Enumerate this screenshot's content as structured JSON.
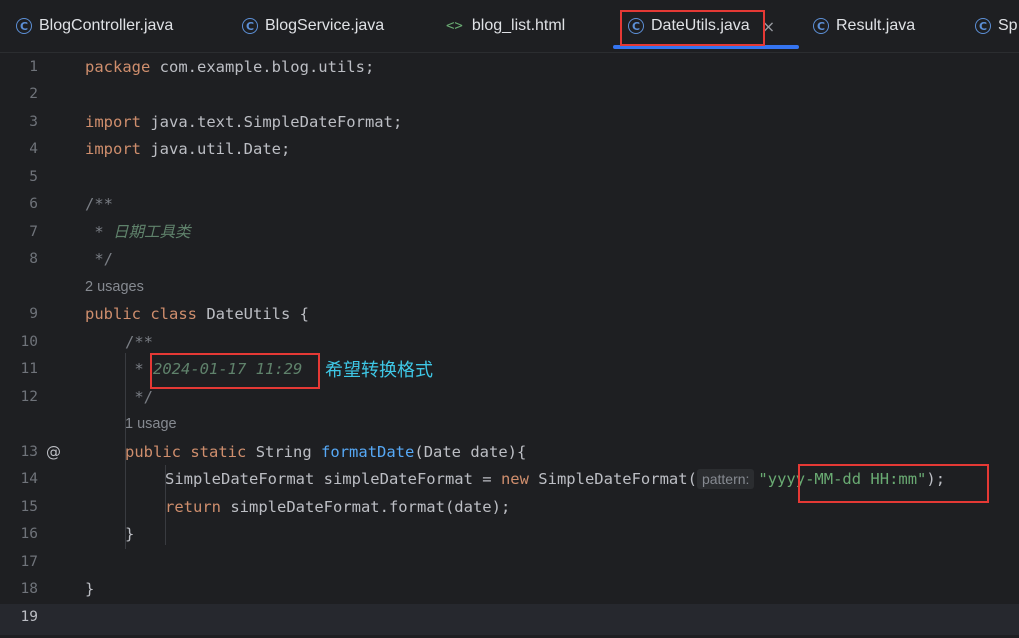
{
  "tabs": [
    {
      "label": "BlogController.java",
      "icon": "class-c-icon"
    },
    {
      "label": "BlogService.java",
      "icon": "class-c-icon"
    },
    {
      "label": "blog_list.html",
      "icon": "html-icon"
    },
    {
      "label": "DateUtils.java",
      "icon": "class-c-icon",
      "active": true
    },
    {
      "label": "Result.java",
      "icon": "class-c-icon"
    },
    {
      "label": "Sp",
      "icon": "class-c-icon"
    }
  ],
  "tab_close_glyph": "×",
  "class_icon_glyph": "C",
  "html_icon_glyph": "<>",
  "gutter_at_glyph": "@",
  "annotation_text": "希望转换格式",
  "colors": {
    "accent": "#3574f0",
    "highlight_box": "#e53935",
    "annotation": "#3ec7e6"
  },
  "code": {
    "l1": {
      "num": "1",
      "kw": "package",
      "rest": " com.example.blog.utils;"
    },
    "l2": {
      "num": "2"
    },
    "l3": {
      "num": "3",
      "kw": "import",
      "rest": " java.text.SimpleDateFormat;"
    },
    "l4": {
      "num": "4",
      "kw": "import",
      "rest": " java.util.Date;"
    },
    "l5": {
      "num": "5"
    },
    "l6": {
      "num": "6",
      "text": "/**"
    },
    "l7": {
      "num": "7",
      "prefix": " * ",
      "doc": "日期工具类"
    },
    "l8": {
      "num": "8",
      "text": " */"
    },
    "hint_class": "2 usages",
    "l9": {
      "num": "9",
      "kw1": "public",
      "kw2": "class",
      "rest": " DateUtils {"
    },
    "l10": {
      "num": "10",
      "text": "/**"
    },
    "l11": {
      "num": "11",
      "prefix": " * ",
      "doc": "2024-01-17 11:29"
    },
    "l12": {
      "num": "12",
      "text": " */"
    },
    "hint_method": "1 usage",
    "l13": {
      "num": "13",
      "kw1": "public",
      "kw2": "static",
      "type": "String",
      "fn": "formatDate",
      "rest": "(Date date){"
    },
    "l14": {
      "num": "14",
      "pre": "SimpleDateFormat simpleDateFormat = ",
      "kw": "new",
      "mid": " SimpleDateFormat(",
      "param": "pattern:",
      "str": "\"yyyy-MM-dd HH:mm\"",
      "end": ");"
    },
    "l15": {
      "num": "15",
      "kw": "return",
      "rest": " simpleDateFormat.format(date);"
    },
    "l16": {
      "num": "16",
      "text": "}"
    },
    "l17": {
      "num": "17"
    },
    "l18": {
      "num": "18",
      "text": "}"
    },
    "l19": {
      "num": "19"
    }
  }
}
